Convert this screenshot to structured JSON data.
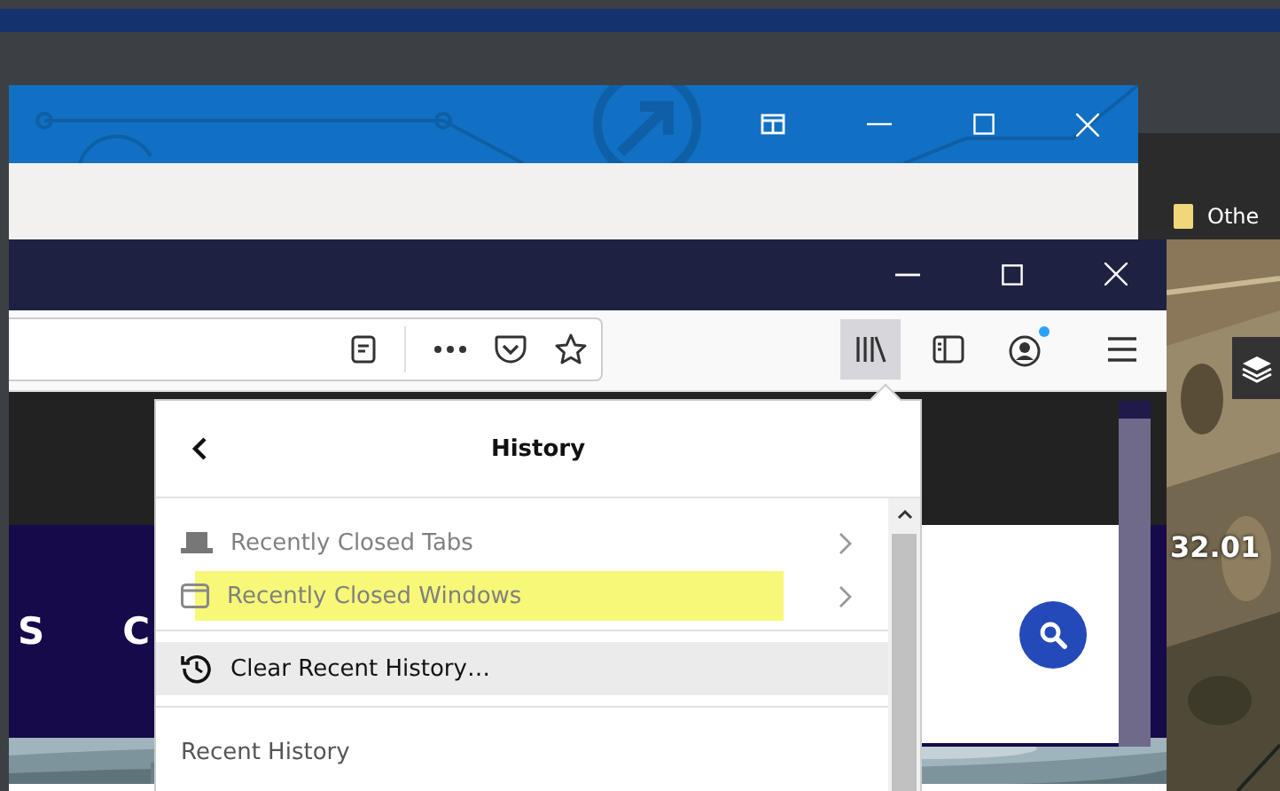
{
  "bookmarks": [
    {
      "label": "Othe"
    }
  ],
  "browser": {
    "toolbar_buttons": [
      {
        "kind": "library",
        "selected": true
      },
      {
        "kind": "sidebar",
        "selected": false
      },
      {
        "kind": "account",
        "selected": false,
        "notification": true
      },
      {
        "kind": "menu",
        "selected": false
      }
    ],
    "page": {
      "letters": [
        "S",
        "C"
      ]
    }
  },
  "map": {
    "label": "32.01"
  },
  "history_panel": {
    "title": "History",
    "items": [
      {
        "kind": "submenu",
        "label": "Recently Closed Tabs",
        "disabled": true,
        "highlighted": false,
        "hovered": false
      },
      {
        "kind": "submenu",
        "label": "Recently Closed Windows",
        "disabled": true,
        "highlighted": true,
        "hovered": false
      },
      {
        "kind": "action",
        "label": "Clear Recent History…",
        "disabled": false,
        "highlighted": false,
        "hovered": true
      }
    ],
    "section": "Recent History"
  }
}
